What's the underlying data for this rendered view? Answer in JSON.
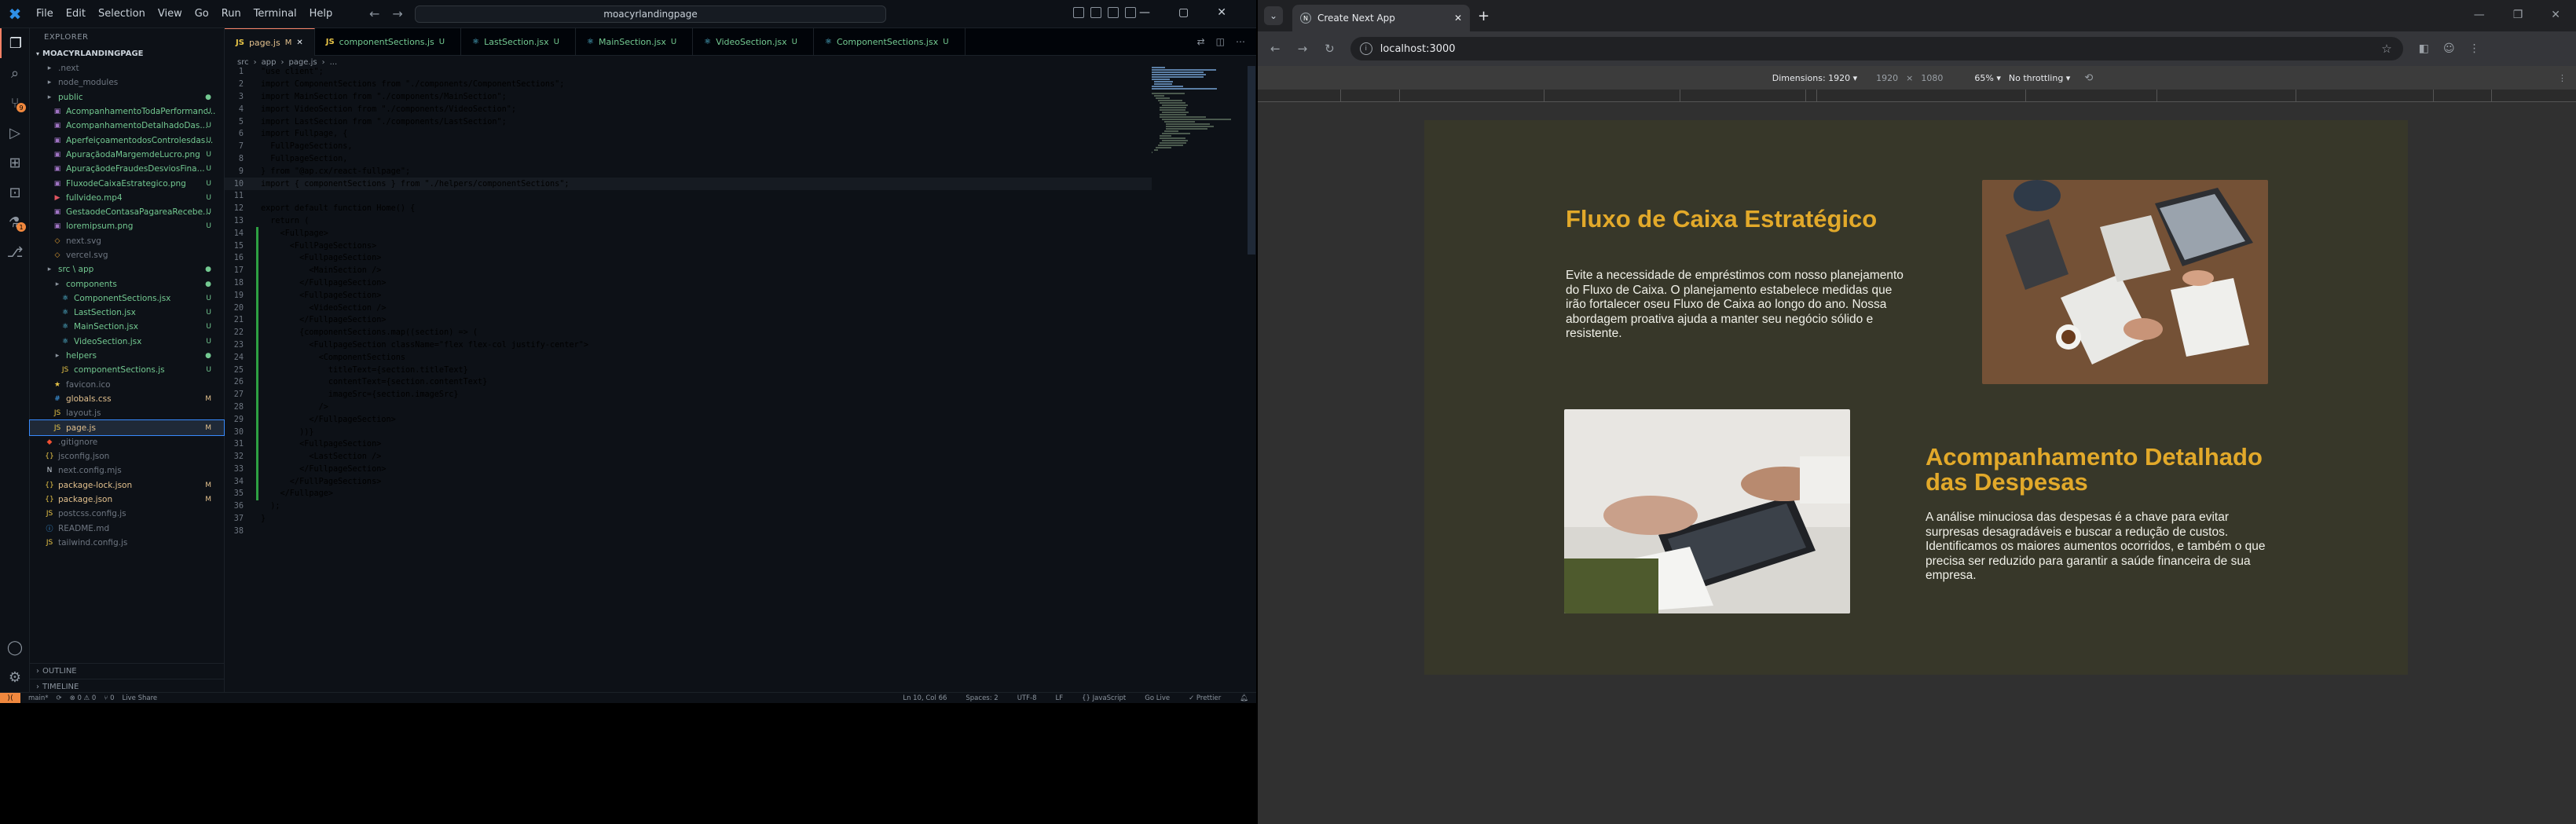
{
  "vscode": {
    "menu": [
      "File",
      "Edit",
      "Selection",
      "View",
      "Go",
      "Run",
      "Terminal",
      "Help"
    ],
    "search": "moacyrlandingpage",
    "sidebar": {
      "header": "EXPLORER",
      "root": "MOACYRLANDINGPAGE",
      "items": [
        {
          "label": ".next",
          "status": "",
          "color": "ignored",
          "icon": "folder-icon",
          "indent": 1
        },
        {
          "label": "node_modules",
          "status": "",
          "color": "ignored",
          "icon": "folder-icon",
          "indent": 1
        },
        {
          "label": "public",
          "status": "●",
          "color": "green",
          "icon": "folder-icon",
          "indent": 1
        },
        {
          "label": "AcompanhamentoTodaPerformanc...",
          "status": "U",
          "color": "green",
          "icon": "image-icon",
          "indent": 2
        },
        {
          "label": "AcompanhamentoDetalhadoDas...",
          "status": "U",
          "color": "green",
          "icon": "image-icon",
          "indent": 2
        },
        {
          "label": "AperfeiçoamentodosControlesdas...",
          "status": "U",
          "color": "green",
          "icon": "image-icon",
          "indent": 2
        },
        {
          "label": "ApuraçãodaMargemdeLucro.png",
          "status": "U",
          "color": "green",
          "icon": "image-icon",
          "indent": 2
        },
        {
          "label": "ApuraçãodeFraudesDesviosFina...",
          "status": "U",
          "color": "green",
          "icon": "image-icon",
          "indent": 2
        },
        {
          "label": "FluxodeCaixaEstrategico.png",
          "status": "U",
          "color": "green",
          "icon": "image-icon",
          "indent": 2
        },
        {
          "label": "fullvideo.mp4",
          "status": "U",
          "color": "green",
          "icon": "video-icon",
          "indent": 2
        },
        {
          "label": "GestaodeContasaPagareaRecebe...",
          "status": "U",
          "color": "green",
          "icon": "image-icon",
          "indent": 2
        },
        {
          "label": "loremipsum.png",
          "status": "U",
          "color": "green",
          "icon": "image-icon",
          "indent": 2
        },
        {
          "label": "next.svg",
          "status": "",
          "color": "ignored",
          "icon": "svg-icon",
          "indent": 2
        },
        {
          "label": "vercel.svg",
          "status": "",
          "color": "ignored",
          "icon": "svg-icon",
          "indent": 2
        },
        {
          "label": "src \\ app",
          "status": "●",
          "color": "green",
          "icon": "folder-icon",
          "indent": 1
        },
        {
          "label": "components",
          "status": "●",
          "color": "green",
          "icon": "folder-icon",
          "indent": 2
        },
        {
          "label": "ComponentSections.jsx",
          "status": "U",
          "color": "green",
          "icon": "react-icon",
          "indent": 3
        },
        {
          "label": "LastSection.jsx",
          "status": "U",
          "color": "green",
          "icon": "react-icon",
          "indent": 3
        },
        {
          "label": "MainSection.jsx",
          "status": "U",
          "color": "green",
          "icon": "react-icon",
          "indent": 3
        },
        {
          "label": "VideoSection.jsx",
          "status": "U",
          "color": "green",
          "icon": "react-icon",
          "indent": 3
        },
        {
          "label": "helpers",
          "status": "●",
          "color": "green",
          "icon": "folder-icon",
          "indent": 2
        },
        {
          "label": "componentSections.js",
          "status": "U",
          "color": "green",
          "icon": "js-icon",
          "indent": 3
        },
        {
          "label": "favicon.ico",
          "status": "",
          "color": "ignored",
          "icon": "ico-icon",
          "indent": 2
        },
        {
          "label": "globals.css",
          "status": "M",
          "color": "mod",
          "icon": "css-icon",
          "indent": 2
        },
        {
          "label": "layout.js",
          "status": "",
          "color": "ignored",
          "icon": "js-icon",
          "indent": 2
        },
        {
          "label": "page.js",
          "status": "M",
          "color": "mod",
          "icon": "js-icon",
          "indent": 2,
          "selected": true
        },
        {
          "label": ".gitignore",
          "status": "",
          "color": "ignored",
          "icon": "git-icon",
          "indent": 1
        },
        {
          "label": "jsconfig.json",
          "status": "",
          "color": "ignored",
          "icon": "json-icon",
          "indent": 1
        },
        {
          "label": "next.config.mjs",
          "status": "",
          "color": "ignored",
          "icon": "next-icon",
          "indent": 1
        },
        {
          "label": "package-lock.json",
          "status": "M",
          "color": "mod",
          "icon": "json-icon",
          "indent": 1
        },
        {
          "label": "package.json",
          "status": "M",
          "color": "mod",
          "icon": "json-icon",
          "indent": 1
        },
        {
          "label": "postcss.config.js",
          "status": "",
          "color": "ignored",
          "icon": "js-icon",
          "indent": 1
        },
        {
          "label": "README.md",
          "status": "",
          "color": "ignored",
          "icon": "info-icon",
          "indent": 1
        },
        {
          "label": "tailwind.config.js",
          "status": "",
          "color": "ignored",
          "icon": "js-icon",
          "indent": 1
        }
      ],
      "outline": "OUTLINE",
      "timeline": "TIMELINE"
    },
    "tabs": [
      {
        "label": "page.js",
        "status": "M",
        "active": true
      },
      {
        "label": "componentSections.js",
        "status": "U"
      },
      {
        "label": "LastSection.jsx",
        "status": "U"
      },
      {
        "label": "MainSection.jsx",
        "status": "U"
      },
      {
        "label": "VideoSection.jsx",
        "status": "U"
      },
      {
        "label": "ComponentSections.jsx",
        "status": "U"
      }
    ],
    "breadcrumb": [
      "src",
      "app",
      "page.js",
      "..."
    ],
    "code": [
      "\"use client\";",
      "import ComponentSections from \"./components/ComponentSections\";",
      "import MainSection from \"./components/MainSection\";",
      "import VideoSection from \"./components/VideoSection\";",
      "import LastSection from \"./components/LastSection\";",
      "import Fullpage, {",
      "  FullPageSections,",
      "  FullpageSection,",
      "} from \"@ap.cx/react-fullpage\";",
      "import { componentSections } from \"./helpers/componentSections\";",
      "",
      "export default function Home() {",
      "  return (",
      "    <Fullpage>",
      "      <FullPageSections>",
      "        <FullpageSection>",
      "          <MainSection />",
      "        </FullpageSection>",
      "        <FullpageSection>",
      "          <VideoSection />",
      "        </FullpageSection>",
      "        {componentSections.map((section) => (",
      "          <FullpageSection className=\"flex flex-col justify-center\">",
      "            <ComponentSections",
      "              titleText={section.titleText}",
      "              contentText={section.contentText}",
      "              imageSrc={section.imageSrc}",
      "            />",
      "          </FullpageSection>",
      "        ))}",
      "        <FullpageSection>",
      "          <LastSection />",
      "        </FullpageSection>",
      "      </FullPageSections>",
      "    </Fullpage>",
      "  );",
      "}",
      ""
    ],
    "status": {
      "branch": "main*",
      "sync": "⟳",
      "problems": "⊗ 0  ⚠ 0",
      "ports": "⑂ 0",
      "liveshare": "Live Share",
      "position": "Ln 10, Col 66",
      "spaces": "Spaces: 2",
      "encoding": "UTF-8",
      "eol": "LF",
      "lang": "{} JavaScript",
      "golive": "Go Live",
      "prettier": "✓ Prettier"
    }
  },
  "browser": {
    "tab_title": "Create Next App",
    "url": "localhost:3000",
    "devbar": {
      "dimensions_label": "Dimensions: 1920 ▾",
      "width": "1920",
      "times": "×",
      "height": "1080",
      "zoom": "65% ▾",
      "throttle": "No throttling ▾"
    },
    "page": {
      "section1_title": "Fluxo de Caixa Estratégico",
      "section1_text": "Evite a necessidade de empréstimos com nosso planejamento do Fluxo de Caixa. O planejamento estabelece medidas que irão fortalecer oseu Fluxo de Caixa ao longo do ano. Nossa abordagem proativa ajuda a manter seu negócio sólido e resistente.",
      "section2_title": "Acompanhamento Detalhado das Despesas",
      "section2_text": "A análise minuciosa das despesas é a chave para evitar surpresas desagradáveis e buscar a redução de custos. Identificamos os maiores aumentos ocorridos, e também o que precisa ser reduzido para garantir a saúde financeira de sua empresa."
    }
  },
  "colors": {
    "accent_gold": "#e2a92a",
    "page_bg": "#373729",
    "vscode_bg": "#0d1117",
    "untracked_green": "#73c991",
    "modified_yellow": "#e2c08d"
  }
}
